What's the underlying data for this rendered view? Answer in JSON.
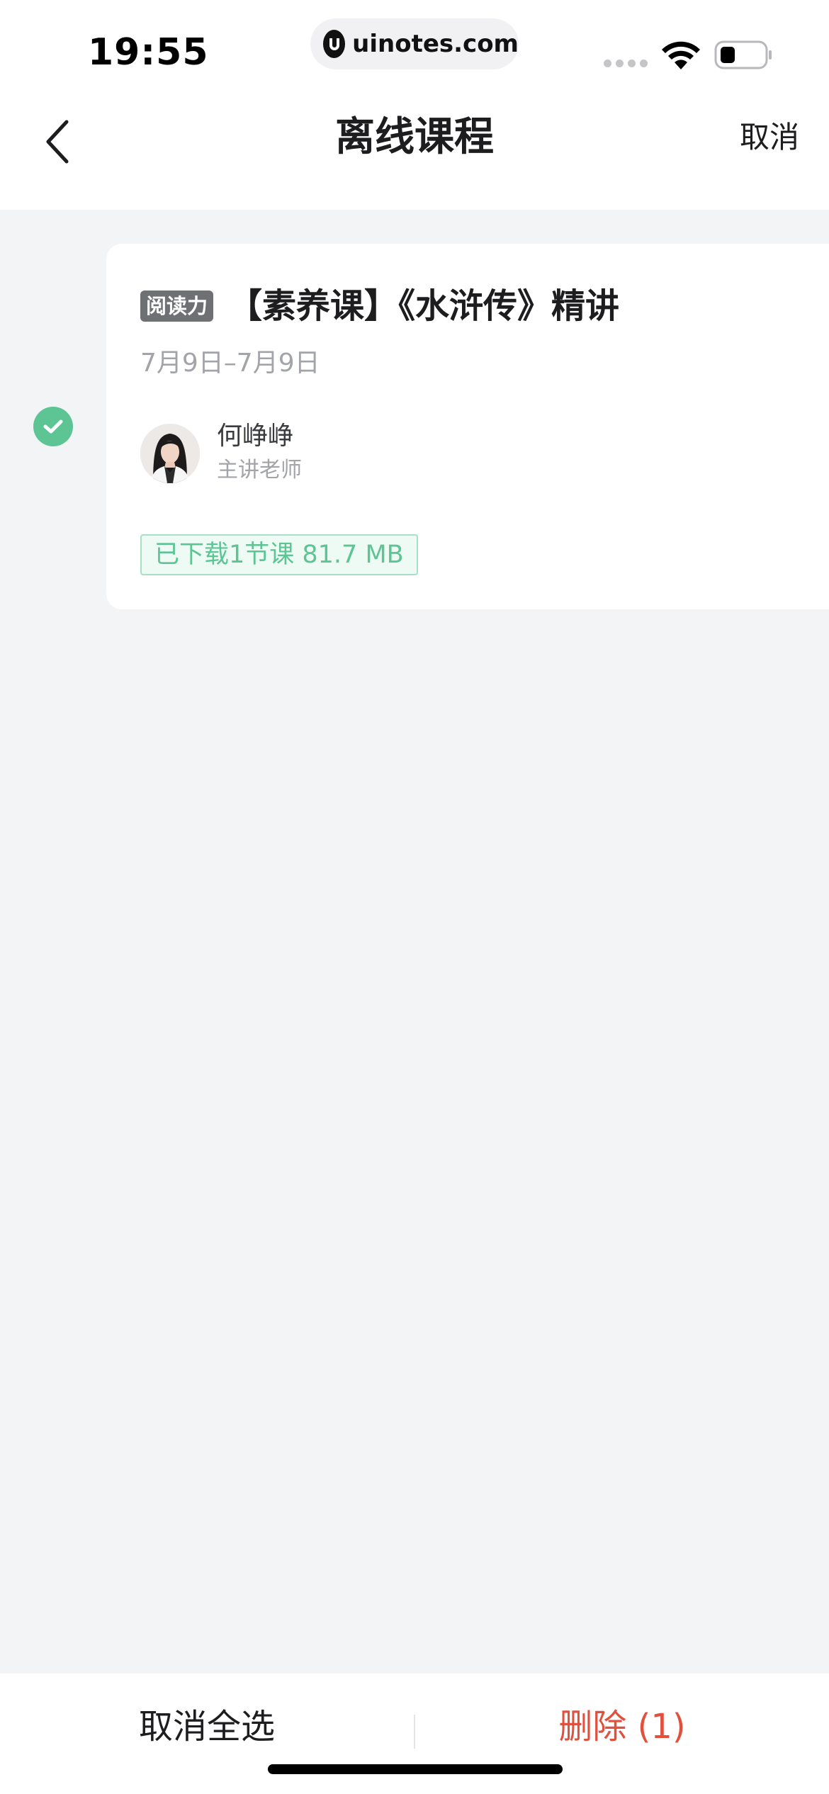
{
  "status_bar": {
    "time": "19:55",
    "url": "uinotes.com",
    "icons": [
      "signal-dots-icon",
      "wifi-icon",
      "battery-icon"
    ]
  },
  "nav": {
    "title": "离线课程",
    "cancel_label": "取消",
    "back_icon": "chevron-left-icon"
  },
  "course": {
    "selected": true,
    "tag": "阅读力",
    "title": "【素养课】《水浒传》精讲",
    "date_range": "7月9日–7月9日",
    "teacher_name": "何峥峥",
    "teacher_role": "主讲老师",
    "download_status": "已下载1节课 81.7 MB"
  },
  "bottom_bar": {
    "deselect_all_label": "取消全选",
    "delete_label": "删除 (1)"
  },
  "colors": {
    "accent_green": "#5cc593",
    "delete_red": "#e0503d",
    "page_bg": "#f3f4f6",
    "tag_bg": "#6f7073"
  }
}
